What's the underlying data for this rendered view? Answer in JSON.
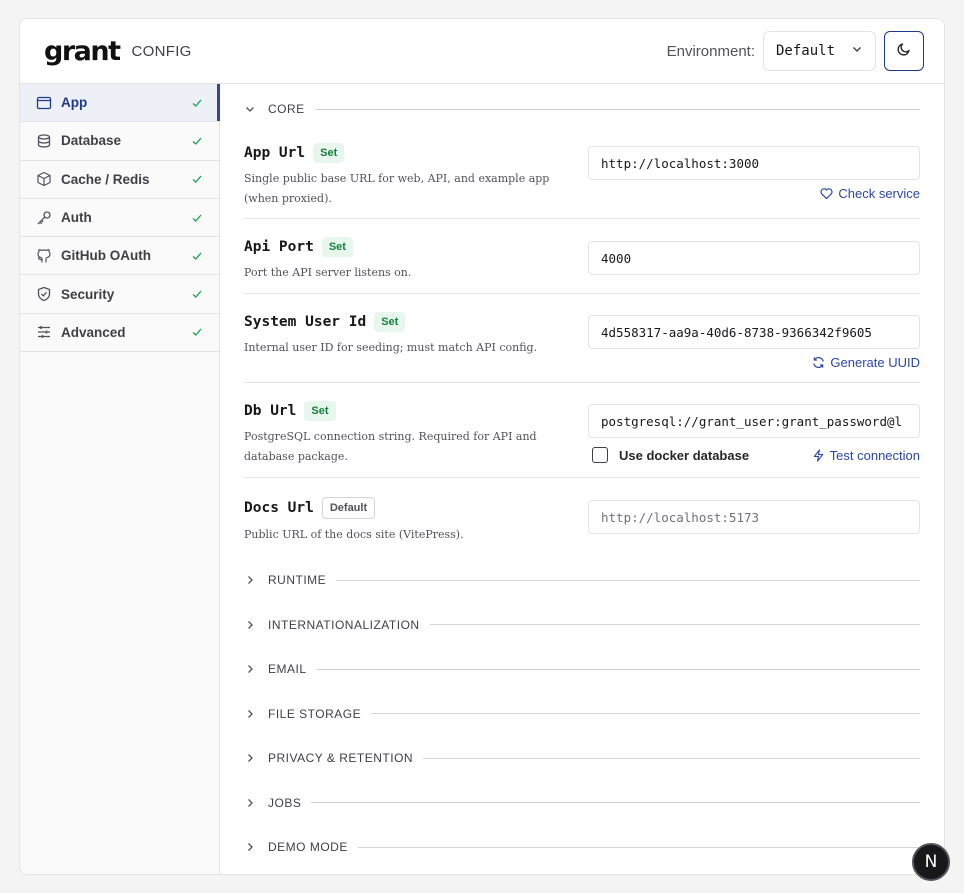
{
  "header": {
    "logo_text": "grant",
    "logo_sub": "CONFIG",
    "environment_label": "Environment:",
    "environment_value": "Default",
    "theme_icon": "moon-icon"
  },
  "sidebar": {
    "items": [
      {
        "label": "App",
        "icon": "window-icon",
        "active": true,
        "status": "check"
      },
      {
        "label": "Database",
        "icon": "database-icon",
        "status": "check"
      },
      {
        "label": "Cache / Redis",
        "icon": "box-icon",
        "status": "check"
      },
      {
        "label": "Auth",
        "icon": "key-icon",
        "status": "check"
      },
      {
        "label": "GitHub OAuth",
        "icon": "github-icon",
        "status": "check"
      },
      {
        "label": "Security",
        "icon": "shield-icon",
        "status": "check"
      },
      {
        "label": "Advanced",
        "icon": "sliders-icon",
        "status": "check"
      }
    ]
  },
  "main": {
    "core_title": "CORE",
    "fields": [
      {
        "label": "App Url",
        "badge": "Set",
        "desc": "Single public base URL for web, API, and example app (when proxied).",
        "value": "http://localhost:3000",
        "action": "Check service"
      },
      {
        "label": "Api Port",
        "badge": "Set",
        "desc": "Port the API server listens on.",
        "value": "4000"
      },
      {
        "label": "System User Id",
        "badge": "Set",
        "desc": "Internal user ID for seeding; must match API config.",
        "value": "4d558317-aa9a-40d6-8738-9366342f9605",
        "action": "Generate UUID"
      },
      {
        "label": "Db Url",
        "badge": "Set",
        "desc": "PostgreSQL connection string. Required for API and database package.",
        "value": "postgresql://grant_user:grant_password@l",
        "checkbox_label": "Use docker database",
        "action": "Test connection"
      },
      {
        "label": "Docs Url",
        "badge": "Default",
        "desc": "Public URL of the docs site (VitePress).",
        "placeholder": "http://localhost:5173"
      }
    ],
    "collapsed_sections": [
      "RUNTIME",
      "INTERNATIONALIZATION",
      "EMAIL",
      "FILE STORAGE",
      "PRIVACY & RETENTION",
      "JOBS",
      "DEMO MODE"
    ]
  },
  "fab_label": "N",
  "colors": {
    "accent": "#2d47a8",
    "success": "#15803d",
    "check": "#16a34a"
  }
}
